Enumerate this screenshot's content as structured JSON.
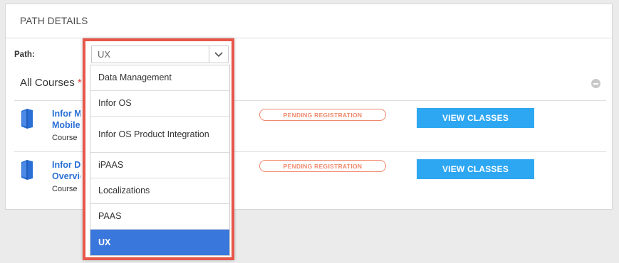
{
  "panel": {
    "title": "PATH DETAILS"
  },
  "path": {
    "label": "Path:",
    "selected": "UX",
    "options": [
      "Data Management",
      "Infor OS",
      "Infor OS Product Integration",
      "iPAAS",
      "Localizations",
      "PAAS",
      "UX"
    ]
  },
  "courses": {
    "title": "All Courses",
    "required_marker": "*",
    "items": [
      {
        "title_line1": "Infor Mi",
        "title_line2": "Mobile T",
        "type": "Course",
        "status": "PENDING REGISTRATION",
        "action": "VIEW CLASSES"
      },
      {
        "title_line1": "Infor Do",
        "title_line2": "Overview",
        "type": "Course",
        "status": "PENDING REGISTRATION",
        "action": "VIEW CLASSES"
      }
    ]
  },
  "colors": {
    "accent": "#2ea7f2",
    "link": "#2a6fd6",
    "status": "#f08a6e",
    "highlight": "#e8574a",
    "selected_option": "#3a77dc"
  },
  "icons": {
    "book": "book-icon",
    "collapse": "minus-circle-icon",
    "chevron": "chevron-down-icon"
  }
}
